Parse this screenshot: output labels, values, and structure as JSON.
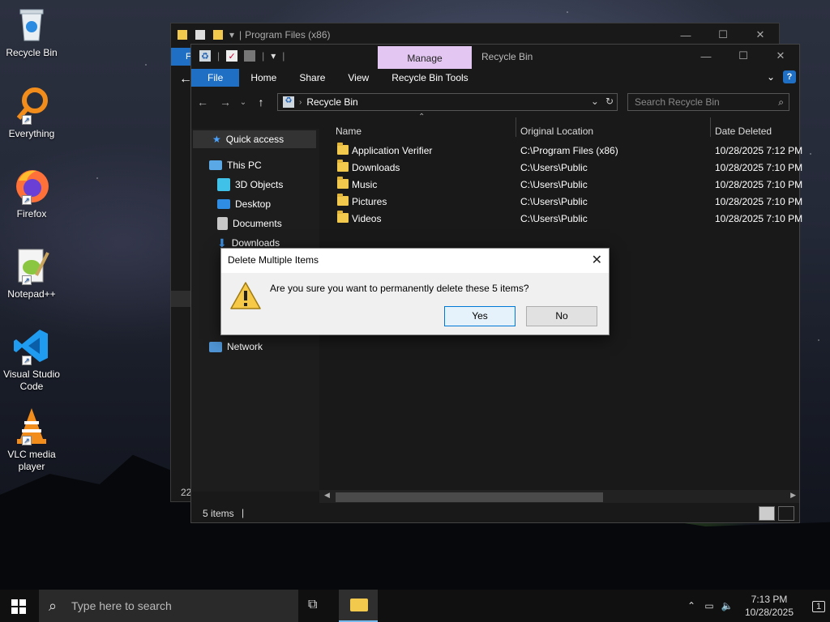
{
  "desktop": {
    "icons": [
      {
        "label": "Recycle Bin"
      },
      {
        "label": "Everything"
      },
      {
        "label": "Firefox"
      },
      {
        "label": "Notepad++"
      },
      {
        "label": "Visual Studio Code"
      },
      {
        "label": "VLC media player"
      }
    ]
  },
  "back_window": {
    "title": "Program Files (x86)",
    "file_tab": "F",
    "status_fragment": "22"
  },
  "front_window": {
    "title": "Recycle Bin",
    "context_tab": "Manage",
    "ribbon_tabs": [
      "File",
      "Home",
      "Share",
      "View",
      "Recycle Bin Tools"
    ],
    "address": "Recycle Bin",
    "search_placeholder": "Search Recycle Bin",
    "nav": {
      "quick_access": "Quick access",
      "this_pc": "This PC",
      "objects_3d": "3D Objects",
      "desktop": "Desktop",
      "documents": "Documents",
      "downloads": "Downloads",
      "network": "Network"
    },
    "columns": {
      "name": "Name",
      "original_location": "Original Location",
      "date_deleted": "Date Deleted"
    },
    "rows": [
      {
        "name": "Application Verifier",
        "location": "C:\\Program Files (x86)",
        "date": "10/28/2025 7:12 PM"
      },
      {
        "name": "Downloads",
        "location": "C:\\Users\\Public",
        "date": "10/28/2025 7:10 PM"
      },
      {
        "name": "Music",
        "location": "C:\\Users\\Public",
        "date": "10/28/2025 7:10 PM"
      },
      {
        "name": "Pictures",
        "location": "C:\\Users\\Public",
        "date": "10/28/2025 7:10 PM"
      },
      {
        "name": "Videos",
        "location": "C:\\Users\\Public",
        "date": "10/28/2025 7:10 PM"
      }
    ],
    "status": "5 items"
  },
  "dialog": {
    "title": "Delete Multiple Items",
    "message": "Are you sure you want to permanently delete these 5 items?",
    "yes": "Yes",
    "no": "No"
  },
  "taskbar": {
    "search_placeholder": "Type here to search",
    "time": "7:13 PM",
    "date": "10/28/2025",
    "notification_count": "1"
  },
  "colors": {
    "accent": "#1f6fc5",
    "manage_tab": "#e3c7f2",
    "folder": "#f2c94c",
    "window_bg": "#191919"
  }
}
